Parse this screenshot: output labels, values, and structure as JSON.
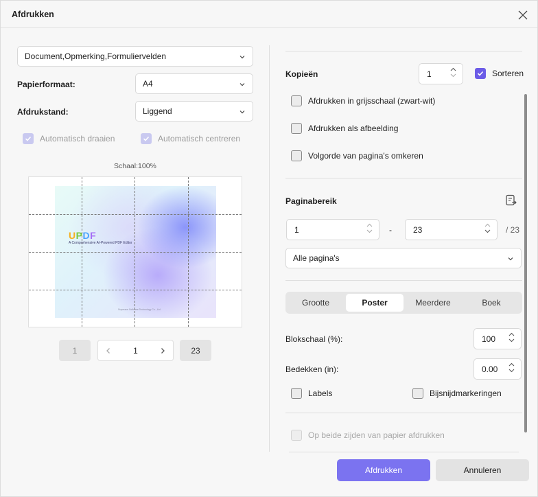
{
  "dialog": {
    "title": "Afdrukken",
    "close_icon": "close-icon"
  },
  "left": {
    "content_select": "Document,Opmerking,Formuliervelden",
    "paper_size_label": "Papierformaat:",
    "paper_size_value": "A4",
    "orientation_label": "Afdrukstand:",
    "orientation_value": "Liggend",
    "auto_rotate": "Automatisch draaien",
    "auto_center": "Automatisch centreren",
    "scale": "Schaal:100%",
    "preview": {
      "logo": "UPDF",
      "subtitle": "A Comprehensive AI-Powered PDF Editor",
      "footer": "Superace Software Technology Co., Ltd.",
      "poster_grid": "4 × 4"
    },
    "pager": {
      "first": "1",
      "current": "1",
      "last": "23",
      "prev_icon": "chevron-left-icon",
      "next_icon": "chevron-right-icon"
    }
  },
  "right": {
    "copies_label": "Kopieën",
    "copies_value": "1",
    "collate_label": "Sorteren",
    "collate_checked": true,
    "grayscale": "Afdrukken in grijsschaal (zwart-wit)",
    "as_image": "Afdrukken als afbeelding",
    "reverse": "Volgorde van pagina's omkeren",
    "range_label": "Paginabereik",
    "range_icon": "swap-pages-icon",
    "range_from": "1",
    "range_dash": "-",
    "range_to": "23",
    "range_total": "/ 23",
    "range_select": "Alle pagina's",
    "tabs": [
      "Grootte",
      "Poster",
      "Meerdere",
      "Boek"
    ],
    "active_tab": "Poster",
    "tile_scale_label": "Blokschaal (%):",
    "tile_scale_value": "100",
    "overlap_label": "Bedekken (in):",
    "overlap_value": "0.00",
    "labels": "Labels",
    "crop_marks": "Bijsnijdmarkeringen",
    "duplex": "Op beide zijden van papier afdrukken"
  },
  "footer": {
    "print_button": "Afdrukken",
    "cancel_button": "Annuleren"
  },
  "colors": {
    "accent": "#7b73f0",
    "checkbox_checked": "#6c5ce7"
  }
}
